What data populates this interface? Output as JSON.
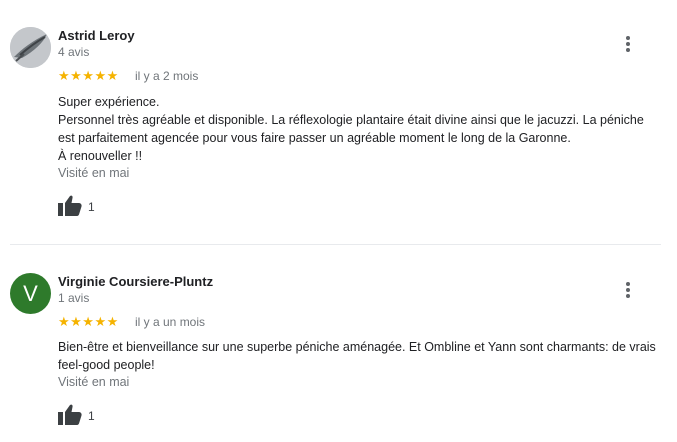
{
  "reviews": [
    {
      "name": "Astrid Leroy",
      "count": "4 avis",
      "stars": "★★★★★",
      "date": "il y a 2 mois",
      "text": "Super expérience.\nPersonnel très agréable et disponible. La réflexologie plantaire était divine ainsi que le jacuzzi. La péniche est parfaitement agencée pour vous faire passer un agréable moment le long de la Garonne.\nÀ renouveller !!",
      "visited": "Visité en mai",
      "likes": "1"
    },
    {
      "name": "Virginie Coursiere-Pluntz",
      "avatar_letter": "V",
      "count": "1 avis",
      "stars": "★★★★★",
      "date": "il y a un mois",
      "text": "Bien-être et bienveillance sur une superbe péniche aménagée. Et Ombline et Yann sont charmants: de vrais feel-good people!",
      "visited": "Visité en mai",
      "likes": "1"
    }
  ],
  "colors": {
    "star": "#f5b300",
    "avatar_green": "#2e7a2b",
    "muted_text": "#70757a"
  },
  "icons": {
    "like": "thumbs-up-icon",
    "menu": "more-vert-icon"
  }
}
